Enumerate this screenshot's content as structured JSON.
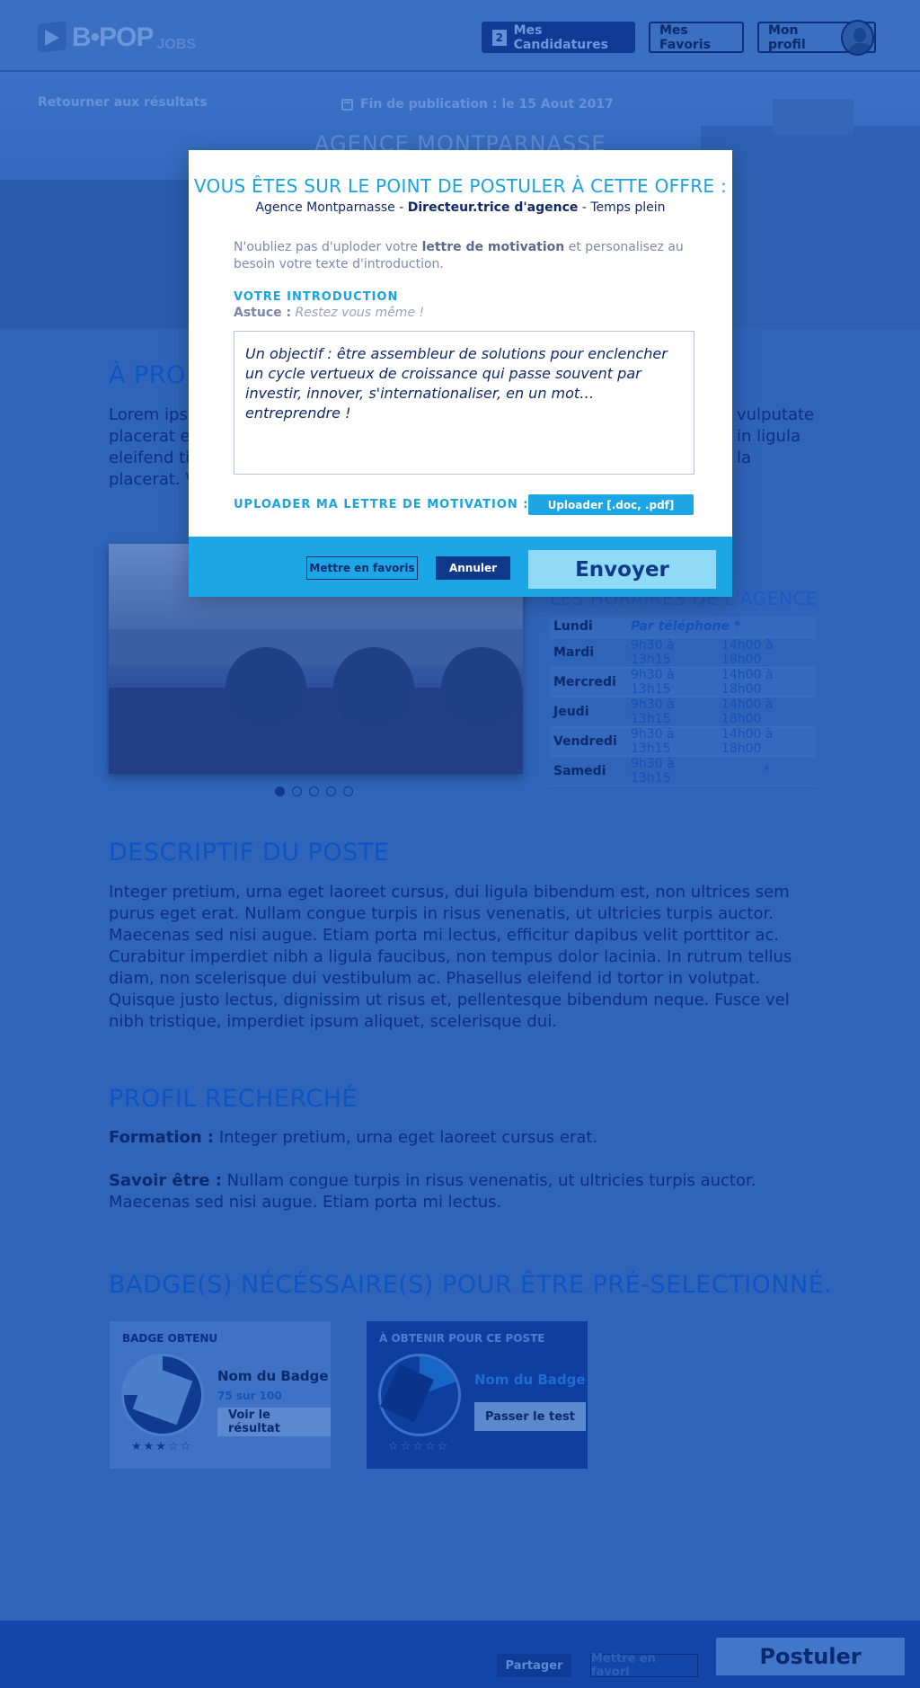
{
  "header": {
    "logo_text": "B•POP",
    "logo_suffix": "JOBS",
    "candidatures_count": "2",
    "candidatures_label": "Mes Candidatures",
    "favoris_label": "Mes Favoris",
    "profil_label": "Mon profil"
  },
  "hero": {
    "back_link": "Retourner aux résultats",
    "publication": "Fin de publication : le 15 Aout 2017",
    "agency_title": "AGENCE MONTPARNASSE"
  },
  "about": {
    "title": "À PROPOS",
    "text_left": "Lorem ipsum\nplacerat ex\neleifend tin\nplacerat. V",
    "text_right": "vulputate\nin ligula\nla"
  },
  "hours": {
    "title": "LES HORAIRES DE L'AGENCE",
    "rows": [
      {
        "day": "Lundi",
        "am": "Par téléphone *",
        "pm": ""
      },
      {
        "day": "Mardi",
        "am": "9h30 à 13h15",
        "pm": "14h00 à 18h00"
      },
      {
        "day": "Mercredi",
        "am": "9h30 à 13h15",
        "pm": "14h00 à 18h00"
      },
      {
        "day": "Jeudi",
        "am": "9h30 à 13h15",
        "pm": "14h00 à 18h00"
      },
      {
        "day": "Vendredi",
        "am": "9h30 à 13h15",
        "pm": "14h00 à 18h00"
      },
      {
        "day": "Samedi",
        "am": "9h30 à 13h15",
        "pm": "*"
      }
    ]
  },
  "carousel": {
    "count": 5,
    "active": 0
  },
  "description": {
    "title": "DESCRIPTIF DU POSTE",
    "text": "Integer pretium, urna eget laoreet cursus, dui ligula bibendum est, non ultrices sem purus eget erat. Nullam congue turpis in risus venenatis, ut ultricies turpis auctor. Maecenas sed nisi augue. Etiam porta mi lectus, efficitur dapibus velit porttitor ac. Curabitur imperdiet nibh a ligula faucibus, non tempus dolor lacinia. In rutrum tellus diam, non scelerisque dui vestibulum ac. Phasellus eleifend id tortor in volutpat. Quisque justo lectus, dignissim ut risus et, pellentesque bibendum neque. Fusce vel nibh tristique, imperdiet ipsum aliquet, scelerisque dui."
  },
  "profile": {
    "title": "PROFIL RECHERCHÉ",
    "formation_label": "Formation :",
    "formation_text": "Integer pretium, urna eget laoreet cursus erat.",
    "savoir_label": "Savoir être :",
    "savoir_text": "Nullam congue turpis in risus venenatis, ut ultricies turpis auctor. Maecenas sed nisi augue. Etiam porta mi lectus."
  },
  "badges": {
    "title": "BADGE(S) NÉCÉSSAIRE(S) POUR ÊTRE PRÉ-SELECTIONNÉ.",
    "obtained": {
      "label": "BADGE OBTENU",
      "name": "Nom du Badge",
      "score": "75 sur 100",
      "button": "Voir le résultat",
      "stars": "★★★☆☆",
      "rating": 3
    },
    "to_obtain": {
      "label": "À OBTENIR POUR CE POSTE",
      "name": "Nom du Badge",
      "button": "Passer le test",
      "stars": "☆☆☆☆☆",
      "rating": 0
    }
  },
  "footer": {
    "share": "Partager",
    "favorite": "Mettre en favori",
    "apply": "Postuler"
  },
  "modal": {
    "title": "VOUS ÊTES SUR LE POINT DE POSTULER À CETTE OFFRE :",
    "agency": "Agence Montparnasse",
    "separator": " - ",
    "job": "Directeur.trice d'agence",
    "contract": "Temps plein",
    "note_before": "N'oubliez pas d'uploder votre ",
    "note_bold": "lettre de motivation",
    "note_after": " et personalisez au besoin votre texte d'introduction.",
    "section_title": "VOTRE INTRODUCTION",
    "tip_label": "Astuce :",
    "tip_text": "Restez vous même !",
    "intro_text": "Un objectif : être assembleur de solutions pour enclencher un cycle vertueux de croissance qui passe souvent par investir, innover, s'internationaliser, en un mot… entreprendre !",
    "upload_label": "UPLOADER MA LETTRE DE MOTIVATION :",
    "upload_button": "Uploader [.doc, .pdf]",
    "fav_button": "Mettre en favoris",
    "cancel_button": "Annuler",
    "send_button": "Envoyer"
  },
  "colors": {
    "overlay_bg": "#2f64b9",
    "accent": "#1ca6e6",
    "dark_navy": "#0f3a8a"
  }
}
